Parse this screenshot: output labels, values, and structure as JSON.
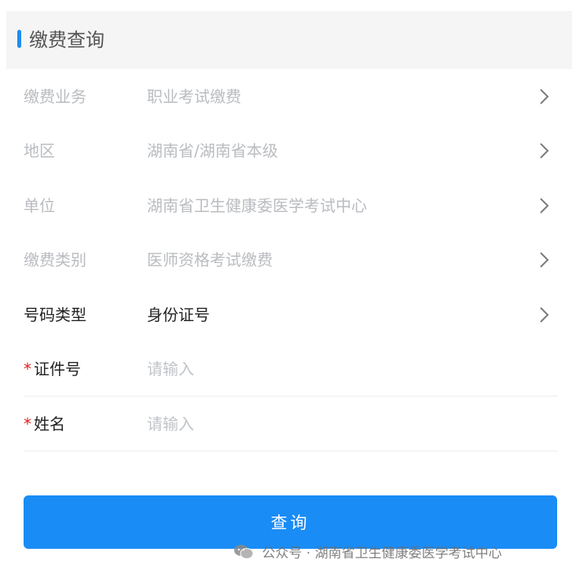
{
  "header": {
    "title": "缴费查询"
  },
  "form": {
    "rows": [
      {
        "label": "缴费业务",
        "value": "职业考试缴费"
      },
      {
        "label": "地区",
        "value": "湖南省/湖南省本级"
      },
      {
        "label": "单位",
        "value": "湖南省卫生健康委医学考试中心"
      },
      {
        "label": "缴费类别",
        "value": "医师资格考试缴费"
      },
      {
        "label": "号码类型",
        "value": "身份证号"
      }
    ],
    "id_field": {
      "required_mark": "*",
      "label": "证件号",
      "placeholder": "请输入"
    },
    "name_field": {
      "required_mark": "*",
      "label": "姓名",
      "placeholder": "请输入"
    }
  },
  "query_button": {
    "label": "查询"
  },
  "watermark": {
    "text": "公众号 · 湖南省卫生健康委医学考试中心"
  }
}
